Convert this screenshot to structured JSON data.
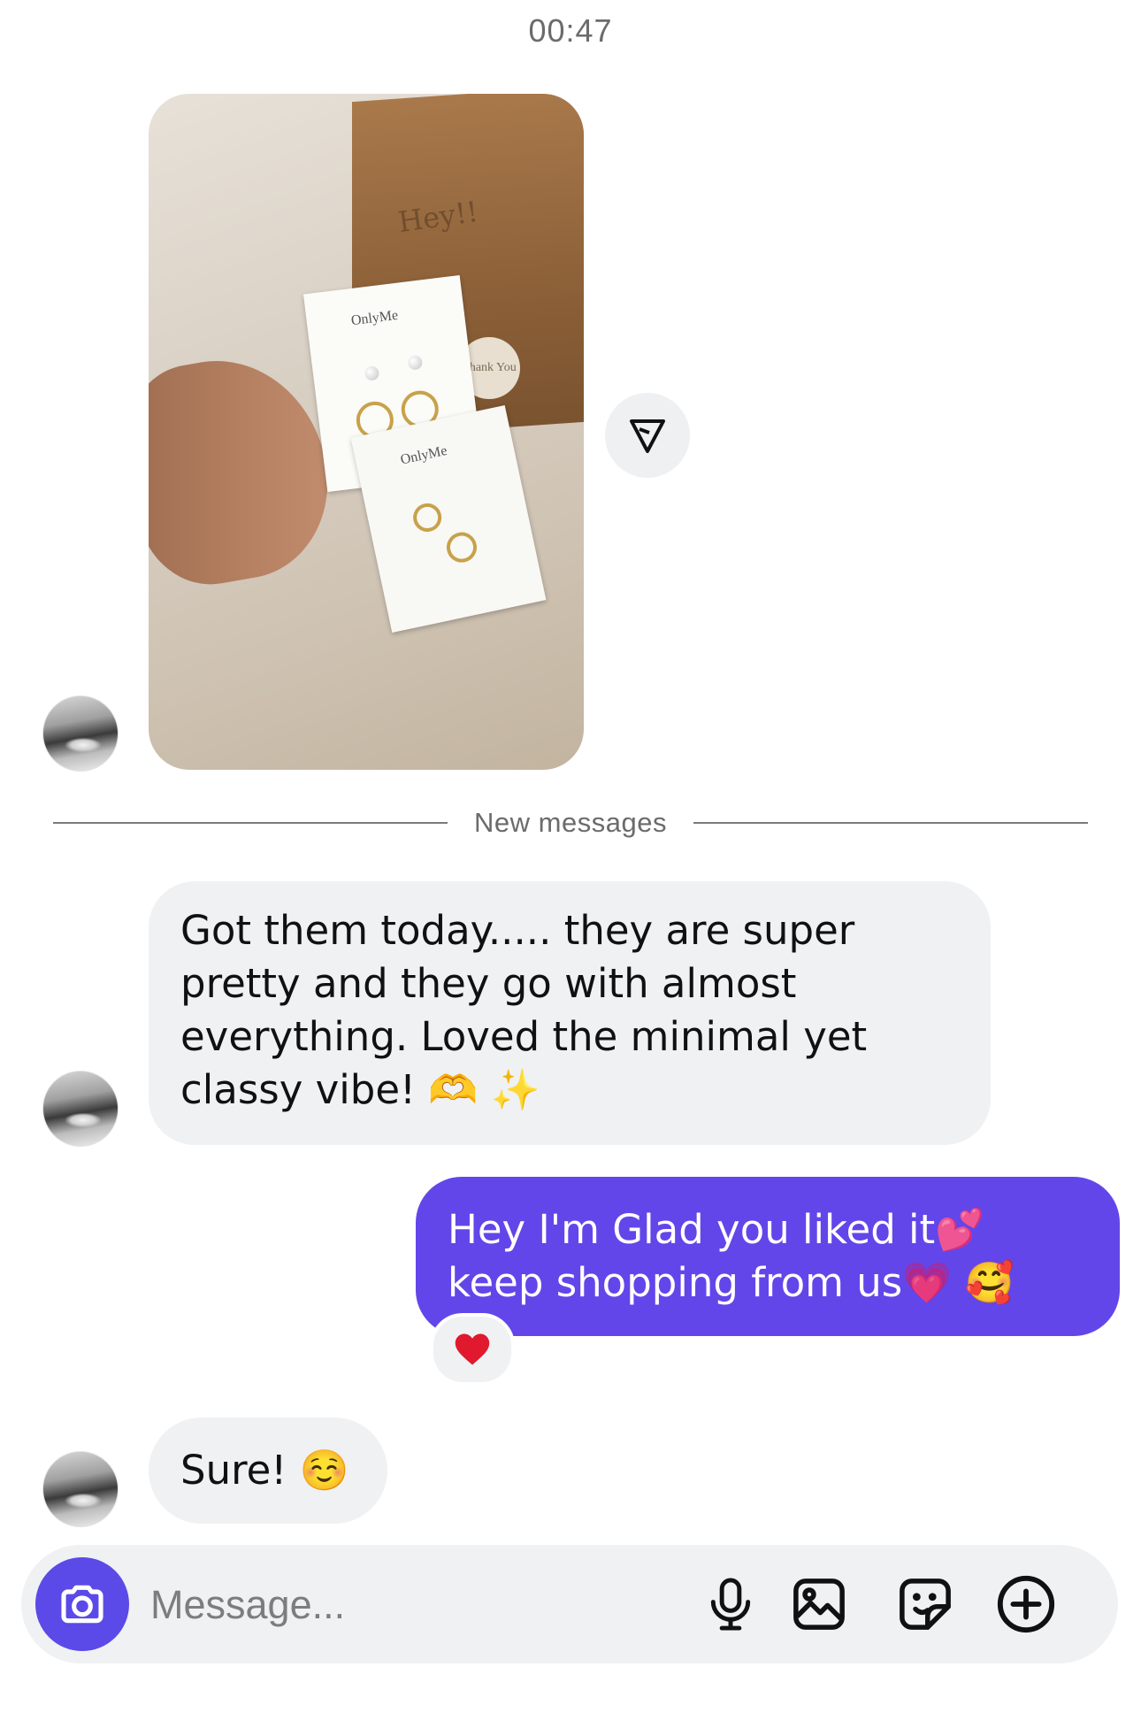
{
  "status": {
    "timestamp": "00:47"
  },
  "thread": {
    "photo": {
      "box_text": "Hey!!",
      "card_brand": "OnlyMe",
      "sticker_text": "Thank You"
    },
    "divider_label": "New messages",
    "messages": [
      {
        "from": "them",
        "text": "Got them today..... they are super pretty and they go with almost everything. Loved the minimal yet classy vibe! 🫶 ✨"
      },
      {
        "from": "me",
        "text": "Hey I'm Glad you liked it💕 keep shopping from us💗 🥰",
        "reaction": "❤️"
      },
      {
        "from": "them",
        "text": "Sure! ☺️"
      }
    ]
  },
  "composer": {
    "placeholder": "Message...",
    "icons": [
      "camera-icon",
      "microphone-icon",
      "gallery-icon",
      "sticker-icon",
      "plus-icon"
    ]
  },
  "colors": {
    "accent": "#6246ea",
    "incoming_bubble": "#f0f1f3",
    "camera_button": "#5b4ae8"
  }
}
